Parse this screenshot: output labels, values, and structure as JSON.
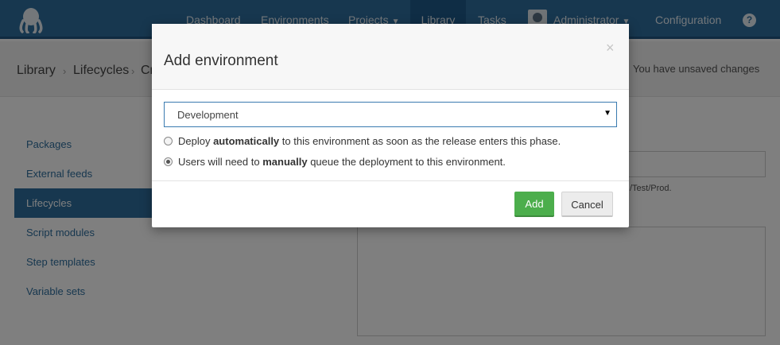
{
  "nav": {
    "items": [
      {
        "label": "Dashboard"
      },
      {
        "label": "Environments"
      },
      {
        "label": "Projects"
      },
      {
        "label": "Library"
      },
      {
        "label": "Tasks"
      },
      {
        "label": "Administrator"
      },
      {
        "label": "Configuration"
      }
    ],
    "help_glyph": "?"
  },
  "breadcrumb": {
    "items": [
      "Library",
      "Lifecycles",
      "Cr"
    ],
    "unsaved": "You have unsaved changes"
  },
  "sidebar": {
    "items": [
      {
        "label": "Packages"
      },
      {
        "label": "External feeds"
      },
      {
        "label": "Lifecycles"
      },
      {
        "label": "Script modules"
      },
      {
        "label": "Step templates"
      },
      {
        "label": "Variable sets"
      }
    ]
  },
  "form": {
    "help_text": "/Test/Prod."
  },
  "modal": {
    "title": "Add environment",
    "close_glyph": "×",
    "select_value": "Development",
    "option_auto": {
      "before": "Deploy ",
      "bold": "automatically",
      "after": " to this environment as soon as the release enters this phase."
    },
    "option_manual": {
      "before": "Users will need to ",
      "bold": "manually",
      "after": " queue the deployment to this environment."
    },
    "selected_option": "manual",
    "add_label": "Add",
    "cancel_label": "Cancel"
  },
  "colors": {
    "nav": "#2f6f9f",
    "primary_button": "#4cae4c"
  }
}
